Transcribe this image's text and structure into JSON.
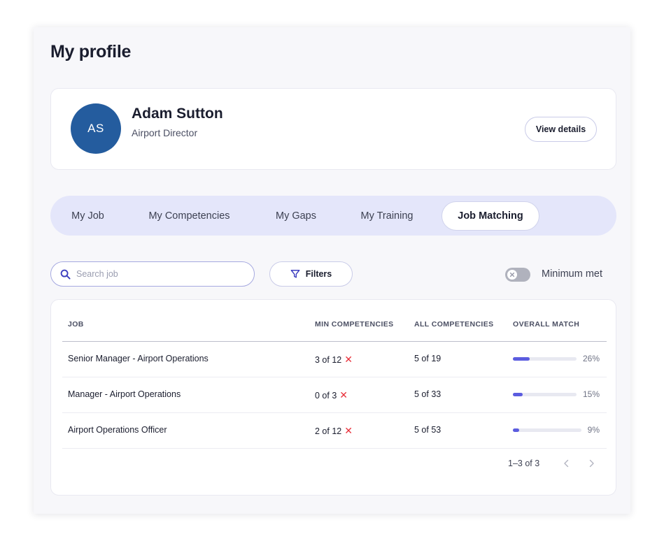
{
  "page": {
    "title": "My profile"
  },
  "profile": {
    "initials": "AS",
    "name": "Adam Sutton",
    "role": "Airport Director",
    "view_details_label": "View details",
    "avatar_color": "#245c9e"
  },
  "tabs": [
    {
      "label": "My Job",
      "active": false
    },
    {
      "label": "My Competencies",
      "active": false
    },
    {
      "label": "My Gaps",
      "active": false
    },
    {
      "label": "My Training",
      "active": false
    },
    {
      "label": "Job Matching",
      "active": true
    }
  ],
  "toolbar": {
    "search_placeholder": "Search job",
    "search_value": "",
    "filters_label": "Filters",
    "minimum_met_label": "Minimum met",
    "minimum_met_on": false
  },
  "table": {
    "columns": [
      "JOB",
      "MIN COMPETENCIES",
      "ALL COMPETENCIES",
      "OVERALL MATCH"
    ],
    "rows": [
      {
        "job": "Senior Manager - Airport Operations",
        "min_competencies": "3 of 12",
        "min_met": false,
        "all_competencies": "5 of 19",
        "match_label": "26%",
        "match_value": 0.26
      },
      {
        "job": "Manager - Airport Operations",
        "min_competencies": "0 of 3",
        "min_met": false,
        "all_competencies": "5 of 33",
        "match_label": "15%",
        "match_value": 0.15
      },
      {
        "job": "Airport Operations Officer",
        "min_competencies": "2 of 12",
        "min_met": false,
        "all_competencies": "5 of 53",
        "match_label": "9%",
        "match_value": 0.09
      }
    ],
    "pagination": {
      "range": "1–3 of 3"
    }
  },
  "colors": {
    "accent": "#5b5cdf",
    "tab_bar": "#e4e6fa",
    "fail": "#e8303a"
  },
  "icons": {
    "search": "search-icon",
    "filter": "filter-icon",
    "toggle_off": "close-icon",
    "cross": "cross-icon",
    "prev": "chevron-left-icon",
    "next": "chevron-right-icon"
  }
}
